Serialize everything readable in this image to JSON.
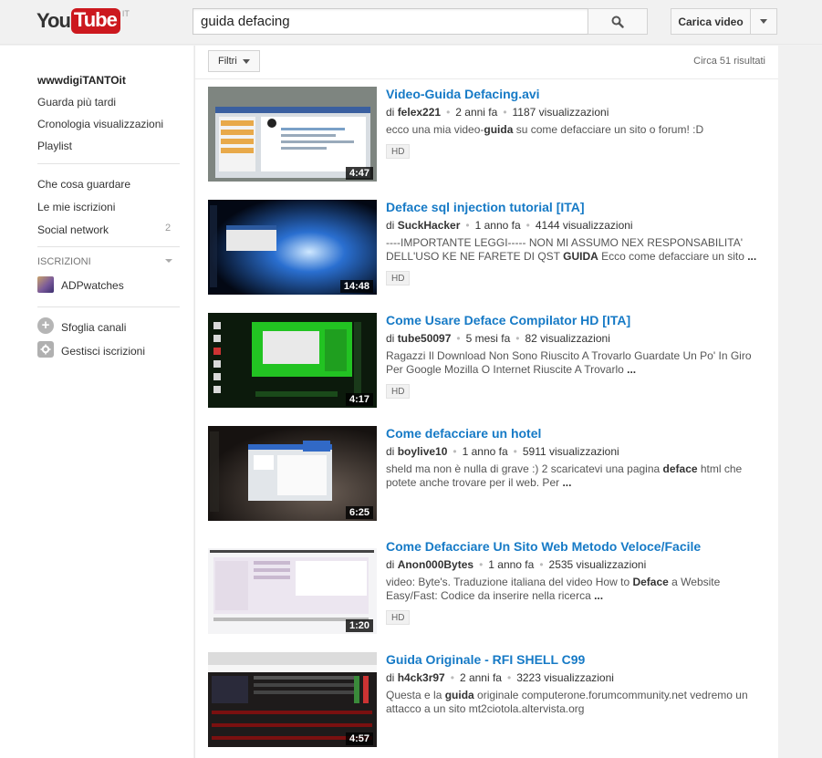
{
  "header": {
    "logo_you": "You",
    "logo_tube": "Tube",
    "logo_country": "IT",
    "search_value": "guida defacing",
    "upload_label": "Carica video"
  },
  "sidebar": {
    "username": "wwwdigiTANTOit",
    "links_top": [
      "Guarda più tardi",
      "Cronologia visualizzazioni",
      "Playlist"
    ],
    "links_mid": [
      "Che cosa guardare",
      "Le mie iscrizioni",
      "Social network"
    ],
    "social_count": "2",
    "subscriptions_heading": "ISCRIZIONI",
    "subscription": "ADPwatches",
    "browse_channels": "Sfoglia canali",
    "manage_subscriptions": "Gestisci iscrizioni"
  },
  "results_header": {
    "filter_label": "Filtri",
    "count": "Circa 51 risultati"
  },
  "results": [
    {
      "title": "Video-Guida Defacing.avi",
      "by": "di",
      "author": "felex221",
      "age": "2 anni fa",
      "views": "1187 visualizzazioni",
      "desc_parts": [
        "ecco una mia video-",
        "guida",
        " su come defacciare un sito o forum! :D"
      ],
      "hd": "HD",
      "duration": "4:47"
    },
    {
      "title": "Deface sql injection tutorial [ITA]",
      "by": "di",
      "author": "SuckHacker",
      "age": "1 anno fa",
      "views": "4144 visualizzazioni",
      "desc_parts": [
        "----IMPORTANTE LEGGI----- NON MI ASSUMO NEX RESPONSABILITA' DELL'USO KE NE FARETE DI QST ",
        "GUIDA",
        " Ecco come defacciare un sito ",
        "..."
      ],
      "hd": "HD",
      "duration": "14:48"
    },
    {
      "title": "Come Usare Deface Compilator HD [ITA]",
      "by": "di",
      "author": "tube50097",
      "age": "5 mesi fa",
      "views": "82 visualizzazioni",
      "desc_parts": [
        "Ragazzi Il Download Non Sono Riuscito A Trovarlo Guardate Un Po' In Giro Per Google Mozilla O Internet Riuscite A Trovarlo ",
        "..."
      ],
      "hd": "HD",
      "duration": "4:17"
    },
    {
      "title": "Come defacciare un hotel",
      "by": "di",
      "author": "boylive10",
      "age": "1 anno fa",
      "views": "5911 visualizzazioni",
      "desc_parts": [
        "sheld ma non è nulla di grave :) 2 scaricatevi una pagina ",
        "deface",
        " html che potete anche trovare per il web. Per ",
        "..."
      ],
      "hd": "",
      "duration": "6:25"
    },
    {
      "title": "Come Defacciare Un Sito Web Metodo Veloce/Facile",
      "by": "di",
      "author": "Anon000Bytes",
      "age": "1 anno fa",
      "views": "2535 visualizzazioni",
      "desc_parts": [
        "video: Byte's. Traduzione italiana del video How to ",
        "Deface",
        " a Website Easy/Fast: Codice da inserire nella ricerca ",
        "..."
      ],
      "hd": "HD",
      "duration": "1:20"
    },
    {
      "title": "Guida Originale - RFI SHELL C99",
      "by": "di",
      "author": "h4ck3r97",
      "age": "2 anni fa",
      "views": "3223 visualizzazioni",
      "desc_parts": [
        "Questa e la ",
        "guida",
        " originale computerone.forumcommunity.net vedremo un attacco a un sito mt2ciotola.altervista.org"
      ],
      "hd": "",
      "duration": "4:57"
    }
  ]
}
